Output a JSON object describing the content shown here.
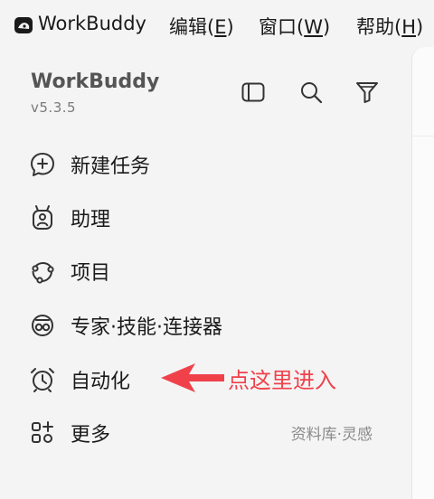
{
  "menubar": {
    "app_name": "WorkBuddy",
    "items": [
      {
        "label": "编辑",
        "key": "E"
      },
      {
        "label": "窗口",
        "key": "W"
      },
      {
        "label": "帮助",
        "key": "H"
      }
    ]
  },
  "sidebar": {
    "brand": "WorkBuddy",
    "version": "v5.3.5",
    "tools": [
      "sidebar-toggle-icon",
      "search-icon",
      "filter-icon"
    ],
    "nav": [
      {
        "label": "新建任务",
        "icon": "new-task-icon"
      },
      {
        "label": "助理",
        "icon": "assistant-icon"
      },
      {
        "label": "项目",
        "icon": "project-icon"
      },
      {
        "label": "专家·技能·连接器",
        "icon": "experts-icon"
      },
      {
        "label": "自动化",
        "icon": "alarm-clock-icon"
      },
      {
        "label": "更多",
        "icon": "more-grid-icon",
        "hint": "资料库·灵感"
      }
    ]
  },
  "annotation": {
    "text": "点这里进入",
    "color": "#f0414b"
  }
}
